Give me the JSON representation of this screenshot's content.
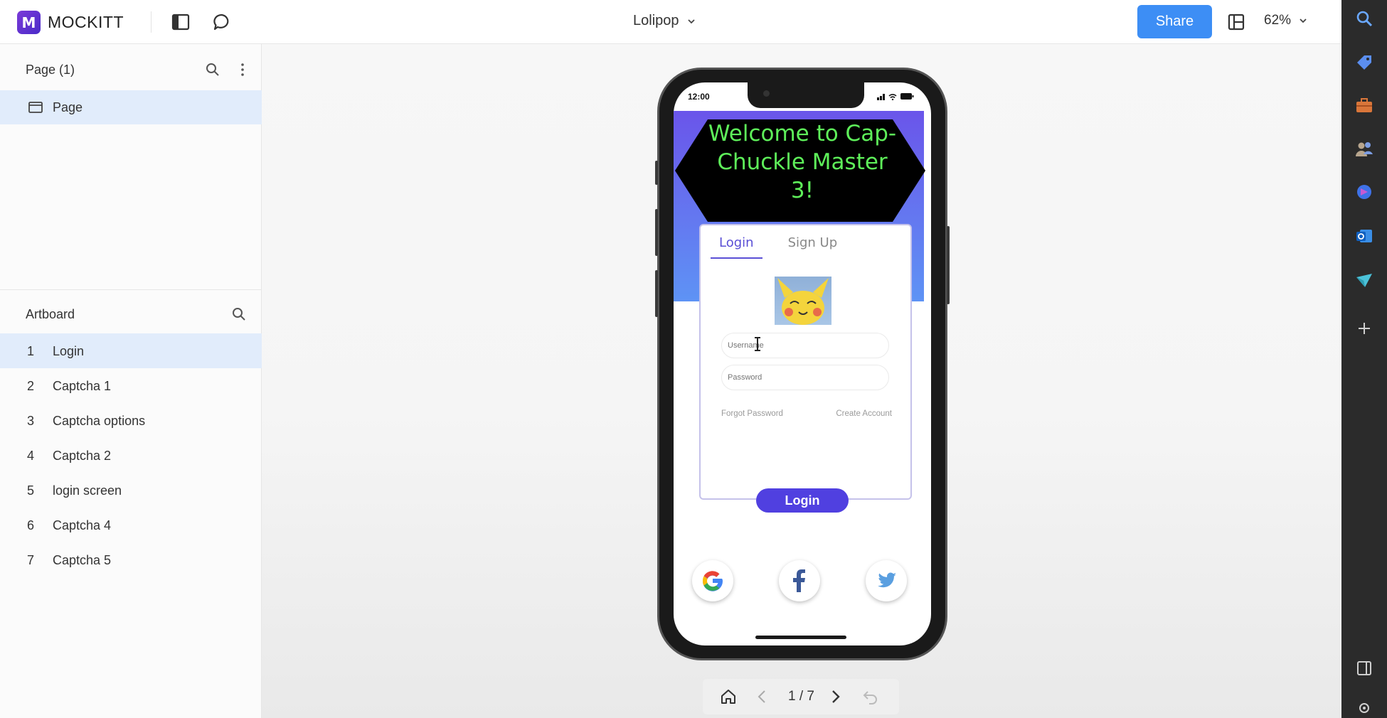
{
  "app": {
    "brand": "MOCKITT",
    "project_name": "Lolipop",
    "share_label": "Share",
    "zoom": "62%"
  },
  "pages_panel": {
    "header": "Page  (1)",
    "items": [
      {
        "label": "Page"
      }
    ]
  },
  "artboard_panel": {
    "header": "Artboard",
    "items": [
      {
        "num": "1",
        "name": "Login"
      },
      {
        "num": "2",
        "name": "Captcha 1"
      },
      {
        "num": "3",
        "name": "Captcha options"
      },
      {
        "num": "4",
        "name": "Captcha 2"
      },
      {
        "num": "5",
        "name": "login screen"
      },
      {
        "num": "6",
        "name": "Captcha 4"
      },
      {
        "num": "7",
        "name": "Captcha 5"
      }
    ]
  },
  "phone": {
    "time": "12:00",
    "welcome_lines": [
      "Welcome to Cap-",
      "Chuckle Master",
      "3!"
    ],
    "tabs": [
      "Login",
      "Sign Up"
    ],
    "username_placeholder": "Username",
    "password_placeholder": "Password",
    "forgot_password": "Forgot Password",
    "create_account": "Create Account",
    "login_button": "Login"
  },
  "preview_nav": {
    "page_indicator": "1 / 7"
  },
  "colors": {
    "accent": "#3d8ef5",
    "welcome_text": "#5ef05a",
    "login_button": "#5040e0",
    "selected_row": "#e1ecfb"
  },
  "icons": {
    "topbar": [
      "sidebar-toggle-icon",
      "comment-icon",
      "chevron-down-icon",
      "layout-icon"
    ],
    "rail": [
      "search-icon",
      "tag-icon",
      "toolbox-icon",
      "users-icon",
      "copilot-icon",
      "outlook-icon",
      "send-icon",
      "plus-icon",
      "panel-icon",
      "settings-icon"
    ],
    "social": [
      "google-icon",
      "facebook-icon",
      "twitter-icon"
    ]
  }
}
